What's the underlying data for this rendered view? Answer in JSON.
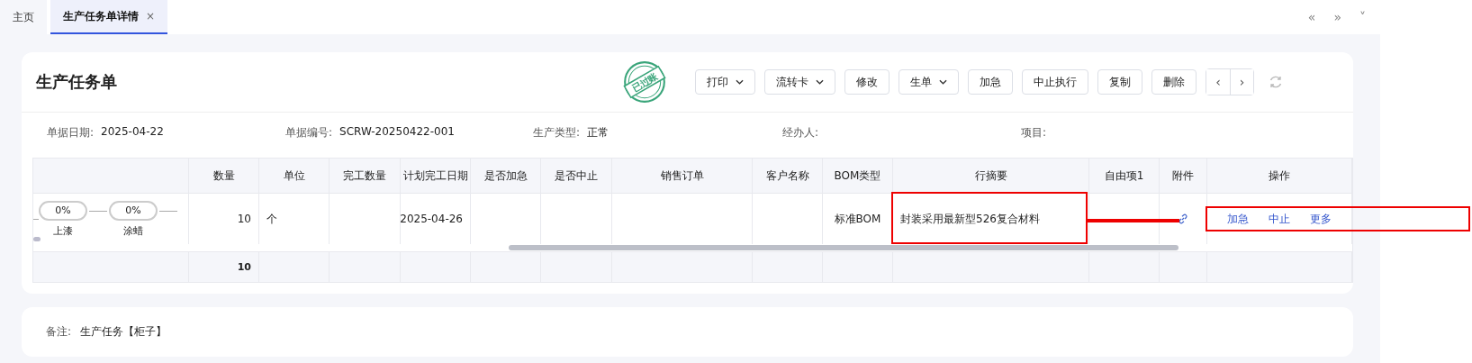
{
  "tabs": [
    {
      "label": "主页",
      "selected": false,
      "closable": false
    },
    {
      "label": "生产任务单详情",
      "selected": true,
      "closable": true,
      "close": "×"
    }
  ],
  "tab_nav": [
    "«",
    "»",
    "˅"
  ],
  "card": {
    "title": "生产任务单",
    "stamp": "已过账",
    "buttons": [
      {
        "label": "打印",
        "dropdown": true
      },
      {
        "label": "流转卡",
        "dropdown": true
      },
      {
        "label": "修改",
        "dropdown": false
      },
      {
        "label": "生单",
        "dropdown": true
      },
      {
        "label": "加急",
        "dropdown": false
      },
      {
        "label": "中止执行",
        "dropdown": false
      },
      {
        "label": "复制",
        "dropdown": false
      },
      {
        "label": "删除",
        "dropdown": false
      }
    ],
    "pager": [
      "‹",
      "›"
    ]
  },
  "fields": [
    {
      "label": "单据日期:",
      "value": "2025-04-22"
    },
    {
      "label": "单据编号:",
      "value": "SCRW-20250422-001"
    },
    {
      "label": "生产类型:",
      "value": "正常"
    },
    {
      "label": "经办人:"
    },
    {
      "label": "项目:"
    }
  ],
  "table": {
    "columns": [
      "数量",
      "单位",
      "完工数量",
      "计划完工日期",
      "是否加急",
      "是否中止",
      "销售订单",
      "客户名称",
      "BOM类型",
      "行摘要",
      "自由项1",
      "附件",
      "操作"
    ],
    "rows": [
      {
        "steps": [
          {
            "percent": "0%",
            "name": "上漆"
          },
          {
            "percent": "0%",
            "name": "涂蜡"
          }
        ],
        "cells": [
          "10",
          "个",
          null,
          "2025-04-26",
          null,
          null,
          null,
          null,
          "标准BOM",
          "封装采用最新型526复合材料",
          null
        ],
        "attachment": true,
        "actions": [
          "加急",
          "中止",
          "更多"
        ]
      }
    ],
    "totals": {
      "quantity": "10"
    }
  },
  "remarks": {
    "label": "备注:",
    "value": "生产任务【柜子】"
  }
}
